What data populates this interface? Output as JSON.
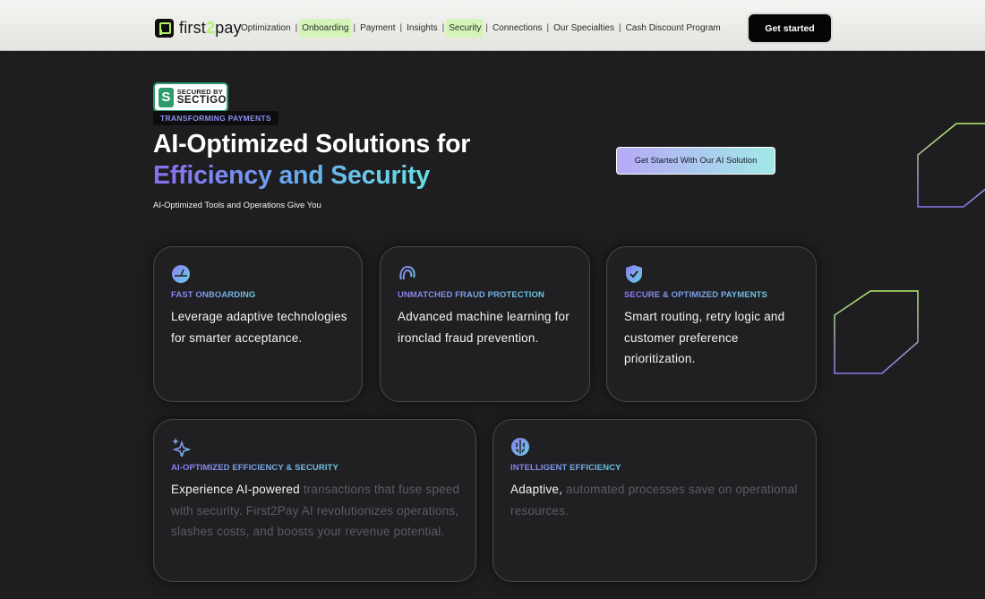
{
  "nav": {
    "logo_text_a": "first",
    "logo_text_b": "2",
    "logo_text_c": "pay",
    "menu": [
      {
        "label": "Optimization",
        "highlight": false
      },
      {
        "label": "Onboarding",
        "highlight": true
      },
      {
        "label": "Payment",
        "highlight": false
      },
      {
        "label": "Insights",
        "highlight": false
      },
      {
        "label": "Security",
        "highlight": true
      },
      {
        "label": "Connections",
        "highlight": false
      },
      {
        "label": "Our Specialties",
        "highlight": false
      },
      {
        "label": "Cash Discount Program",
        "highlight": false
      }
    ],
    "separator": "|",
    "cta_label": "Get started"
  },
  "hero": {
    "badge_top": "SECURED BY",
    "badge_bottom": "SECTIGO",
    "badge_mark": "S",
    "eyebrow": "TRANSFORMING PAYMENTS",
    "title_line1": "AI-Optimized Solutions for",
    "title_line2": "Efficiency and Security",
    "subtitle": "AI-Optimized Tools and Operations Give You",
    "cta_label": "Get Started With Our AI Solution"
  },
  "cards": [
    {
      "icon": "gauge-icon",
      "category": "FAST ONBOARDING",
      "text": "Leverage adaptive technologies for smarter acceptance.",
      "text_dim": ""
    },
    {
      "icon": "fingerprint-icon",
      "category": "UNMATCHED FRAUD PROTECTION",
      "text": "Advanced machine learning for ironclad fraud prevention.",
      "text_dim": ""
    },
    {
      "icon": "shield-check-icon",
      "category": "SECURE & OPTIMIZED PAYMENTS",
      "text": "Smart routing, retry logic and customer preference prioritization.",
      "text_dim": ""
    },
    {
      "icon": "sparkles-icon",
      "category": "AI-OPTIMIZED EFFICIENCY & SECURITY",
      "text": "Experience AI-powered",
      "text_dim": " transactions that fuse speed with security. First2Pay AI revolutionizes operations, slashes costs, and boosts your revenue potential."
    },
    {
      "icon": "brain-icon",
      "category": "INTELLIGENT EFFICIENCY",
      "text": "Adaptive,",
      "text_dim": " automated processes save on operational resources."
    }
  ],
  "colors": {
    "background": "#1e1d1f",
    "accent_green": "#b6f06b",
    "gradient_start": "#8a6cf0",
    "gradient_end": "#66e1e6",
    "nav_highlight": "#d5f5b8"
  }
}
